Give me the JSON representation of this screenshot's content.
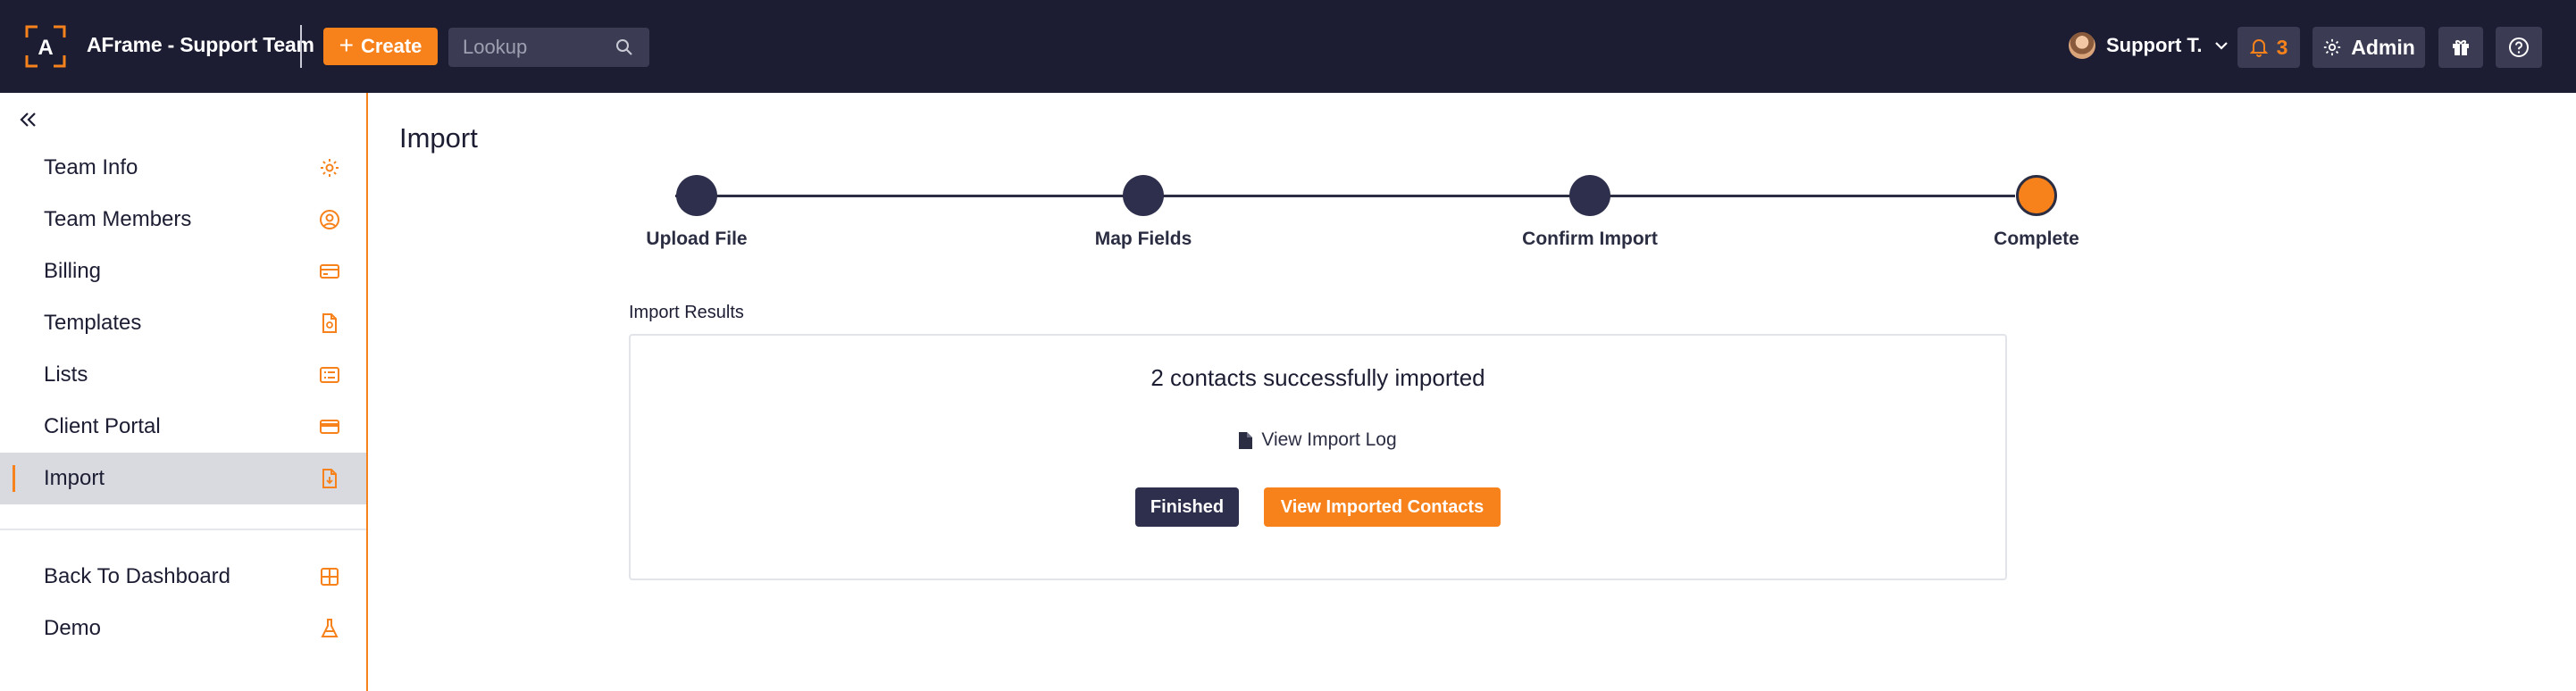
{
  "header": {
    "logo_icon": "aframe-logo-icon",
    "team_name": "AFrame - Support Team",
    "create_label": "Create",
    "lookup_placeholder": "Lookup",
    "user_name": "Support T.",
    "notification_count": "3",
    "admin_label": "Admin",
    "icons": [
      "search-icon",
      "bell-icon",
      "gear-icon",
      "gift-icon",
      "help-icon",
      "chevron-down-icon"
    ]
  },
  "sidebar": {
    "items": [
      {
        "label": "Team Info",
        "icon": "gear-icon",
        "active": false
      },
      {
        "label": "Team Members",
        "icon": "user-circle-icon",
        "active": false
      },
      {
        "label": "Billing",
        "icon": "credit-card-icon",
        "active": false
      },
      {
        "label": "Templates",
        "icon": "document-icon",
        "active": false
      },
      {
        "label": "Lists",
        "icon": "list-icon",
        "active": false
      },
      {
        "label": "Client Portal",
        "icon": "portal-card-icon",
        "active": false
      },
      {
        "label": "Import",
        "icon": "import-file-icon",
        "active": true
      }
    ],
    "footer_items": [
      {
        "label": "Back To Dashboard",
        "icon": "dashboard-grid-icon"
      },
      {
        "label": "Demo",
        "icon": "flask-icon"
      }
    ]
  },
  "main": {
    "title": "Import",
    "steps": [
      {
        "label": "Upload File",
        "state": "done"
      },
      {
        "label": "Map Fields",
        "state": "done"
      },
      {
        "label": "Confirm Import",
        "state": "done"
      },
      {
        "label": "Complete",
        "state": "current"
      }
    ],
    "results_label": "Import Results",
    "success_message": "2 contacts successfully imported",
    "log_link": "View Import Log",
    "finished_label": "Finished",
    "view_contacts_label": "View Imported Contacts"
  },
  "colors": {
    "accent": "#f7821b",
    "topbar": "#1c1d33",
    "dark_button": "#2e2f4c",
    "active_nav_bg": "#d8dadf"
  }
}
